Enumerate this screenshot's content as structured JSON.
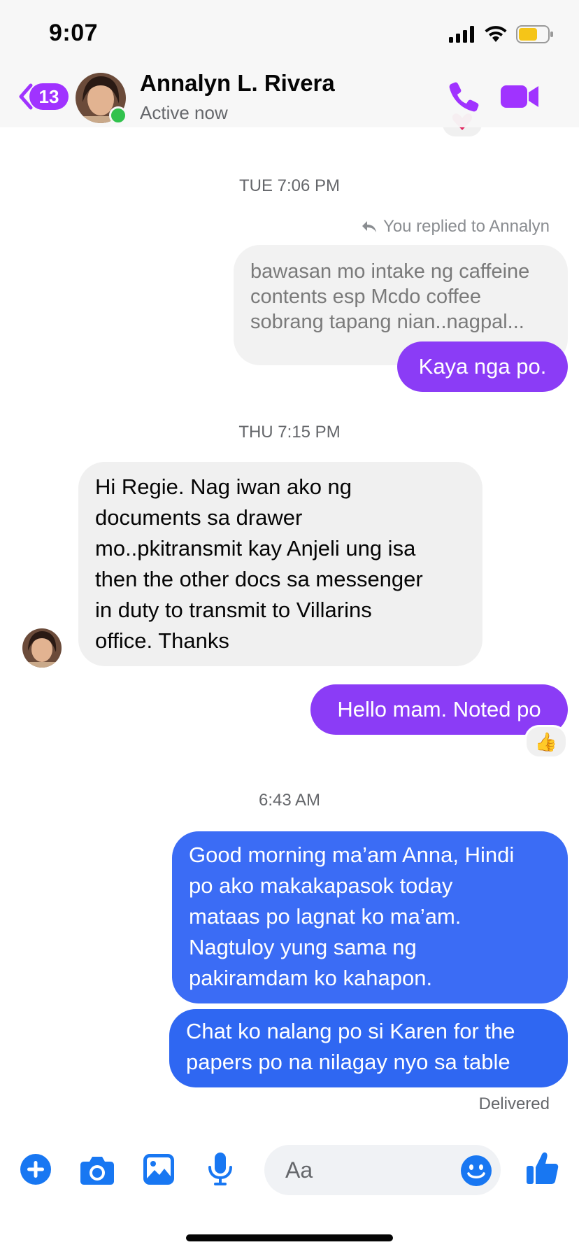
{
  "status_bar": {
    "time": "9:07",
    "icons": [
      "signal-icon",
      "wifi-icon",
      "battery-icon"
    ]
  },
  "header": {
    "back_badge": "13",
    "contact_name": "Annalyn L. Rivera",
    "contact_status": "Active now",
    "icons": [
      "back-chevron-icon",
      "phone-icon",
      "video-camera-icon"
    ],
    "accent_color": "#a033ff"
  },
  "messages": {
    "timestamp1": "TUE 7:06 PM",
    "reply_label": "You replied to Annalyn",
    "quoted_lines": [
      "bawasan mo intake ng caffeine",
      "contents esp Mcdo coffee",
      "sobrang tapang nian..nagpal..."
    ],
    "msg_kaya": "Kaya nga po.",
    "timestamp2": "THU 7:15 PM",
    "incoming_lines": [
      "Hi Regie. Nag iwan ako ng",
      "documents sa drawer",
      "mo..pkitransmit kay Anjeli ung isa",
      "then the other docs sa messenger",
      "in duty to transmit to Villarins",
      "office. Thanks"
    ],
    "msg_noted": "Hello mam. Noted po",
    "reaction_emoji": "👍",
    "timestamp3": "6:43 AM",
    "goodmorning_lines": [
      "Good morning ma’am Anna, Hindi",
      "po ako makakapasok today",
      "mataas po lagnat ko ma’am.",
      "Nagtuloy yung sama ng",
      "pakiramdam ko kahapon."
    ],
    "chat_lines": [
      "Chat ko nalang po si Karen for the",
      "papers po na nilagay nyo sa table"
    ],
    "delivered": "Delivered"
  },
  "composer": {
    "placeholder": "Aa",
    "icons": [
      "plus-icon",
      "camera-icon",
      "photo-icon",
      "microphone-icon",
      "emoji-icon",
      "thumbs-up-icon"
    ],
    "color": "#1877f2"
  }
}
